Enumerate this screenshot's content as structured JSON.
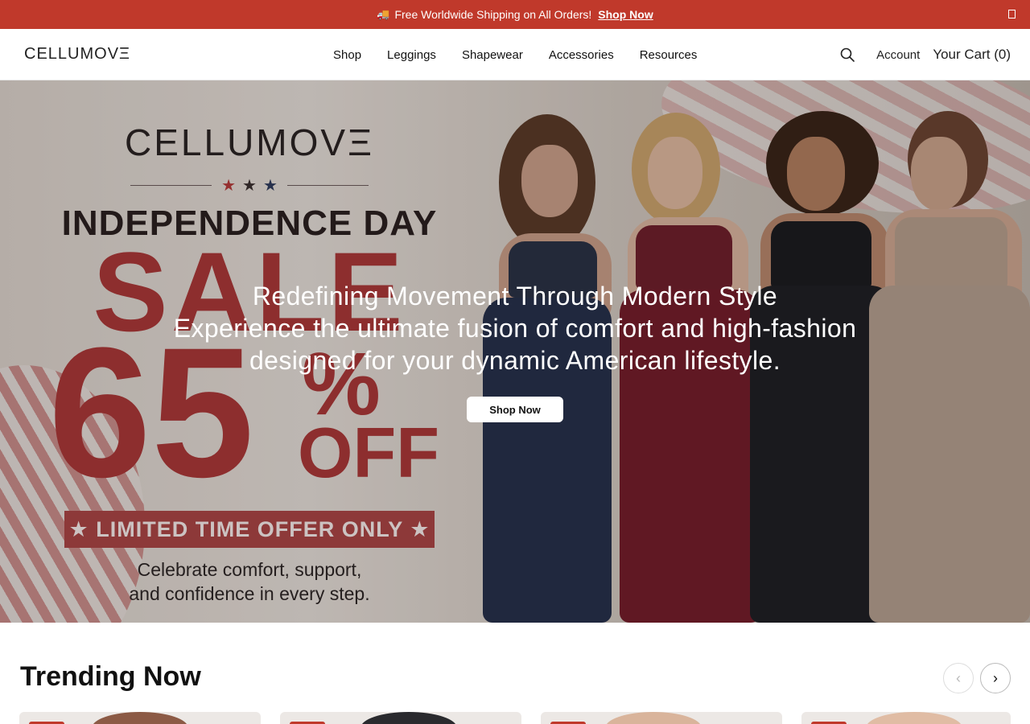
{
  "announcement": {
    "icon": "truck-icon",
    "text": "Free Worldwide Shipping on All Orders!",
    "link_label": "Shop Now",
    "close_glyph": ""
  },
  "header": {
    "logo": "CELLUMOVΞ",
    "nav": [
      "Shop",
      "Leggings",
      "Shapewear",
      "Accessories",
      "Resources"
    ],
    "account_label": "Account",
    "cart_label": "Your Cart (0)"
  },
  "hero": {
    "promo": {
      "logo": "CELLUMOVΞ",
      "stars": [
        "★",
        "★",
        "★"
      ],
      "title": "INDEPENDENCE DAY",
      "sale": "SALE",
      "discount": "65",
      "percent": "%",
      "off": "OFF",
      "ribbon": "★ LIMITED TIME OFFER ONLY ★",
      "subtext_line1": "Celebrate comfort, support,",
      "subtext_line2": "and confidence in every step."
    },
    "heading": "Redefining Movement Through Modern Style",
    "subheading_line1": "Experience the ultimate fusion of comfort and high-fashion",
    "subheading_line2": "designed for your dynamic American lifestyle.",
    "button_label": "Shop Now"
  },
  "trending": {
    "title": "Trending Now",
    "prev_glyph": "‹",
    "next_glyph": "›"
  },
  "colors": {
    "brand_red": "#c0392b",
    "promo_red": "#a83737"
  }
}
